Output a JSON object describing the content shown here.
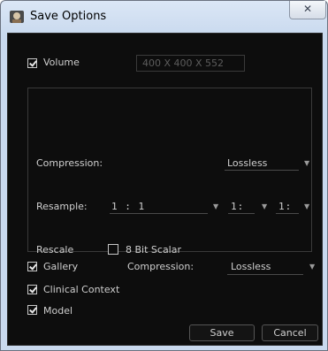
{
  "window": {
    "title": "Save Options",
    "close_glyph": "✕"
  },
  "volume": {
    "label": "Volume",
    "checked": true,
    "dimensions": "400 X 400 X 552"
  },
  "panel": {
    "compression_label": "Compression:",
    "compression_value": "Lossless",
    "resample_label": "Resample:",
    "resample_ratio": "1 : 1",
    "resample_second": "1:",
    "resample_third": "1:",
    "rescale_label": "Rescale",
    "rescale_option_label": "8 Bit Scalar",
    "rescale_checked": false
  },
  "gallery": {
    "label": "Gallery",
    "checked": true,
    "compression_label": "Compression:",
    "compression_value": "Lossless"
  },
  "clinical_context": {
    "label": "Clinical Context",
    "checked": true
  },
  "model": {
    "label": "Model",
    "checked": true
  },
  "buttons": {
    "save": "Save",
    "cancel": "Cancel"
  },
  "colors": {
    "client_bg": "#0d0d0d",
    "text": "#cfcfcf",
    "title_bar": "#c9d9ee"
  },
  "icons": [
    "app-icon",
    "close-icon",
    "checkbox-icon",
    "dropdown-arrow-icon"
  ]
}
